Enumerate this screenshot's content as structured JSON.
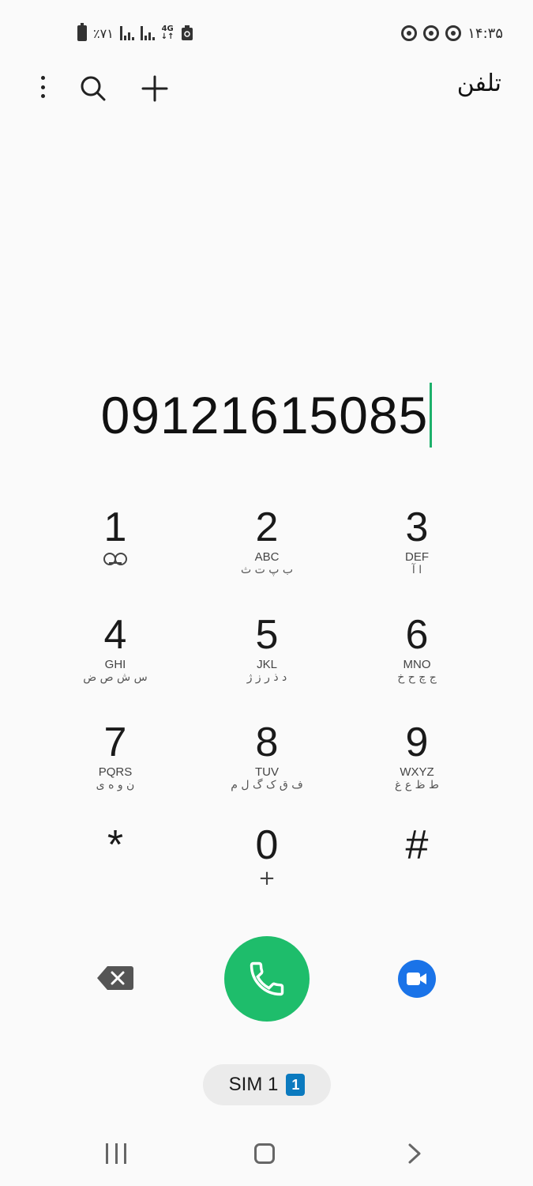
{
  "status_bar": {
    "battery_percent": "٪۷۱",
    "network_type": "4G",
    "time": "۱۴:۳۵"
  },
  "app_bar": {
    "title": "تلفن",
    "icons": [
      "more-options-icon",
      "search-icon",
      "add-icon"
    ]
  },
  "dialer": {
    "number": "09121615085"
  },
  "keypad": {
    "keys": [
      {
        "digit": "1",
        "latin": "",
        "farsi": ""
      },
      {
        "digit": "2",
        "latin": "ABC",
        "farsi": "ب پ ت ث"
      },
      {
        "digit": "3",
        "latin": "DEF",
        "farsi": "ا آ"
      },
      {
        "digit": "4",
        "latin": "GHI",
        "farsi": "س ش ص ض"
      },
      {
        "digit": "5",
        "latin": "JKL",
        "farsi": "د ذ ر ز ژ"
      },
      {
        "digit": "6",
        "latin": "MNO",
        "farsi": "ج چ ح خ"
      },
      {
        "digit": "7",
        "latin": "PQRS",
        "farsi": "ن و ه ی"
      },
      {
        "digit": "8",
        "latin": "TUV",
        "farsi": "ف ق ک گ ل م"
      },
      {
        "digit": "9",
        "latin": "WXYZ",
        "farsi": "ط ظ ع غ"
      },
      {
        "digit": "*",
        "latin": "",
        "farsi": ""
      },
      {
        "digit": "0",
        "latin": "+",
        "farsi": ""
      },
      {
        "digit": "#",
        "latin": "",
        "farsi": ""
      }
    ]
  },
  "actions": {
    "icons": [
      "backspace-icon",
      "phone-icon",
      "video-call-icon"
    ],
    "call_color": "#1ebd6b",
    "video_color": "#1a73e8"
  },
  "sim": {
    "label": "SIM 1",
    "badge": "1"
  },
  "nav_bar": {
    "icons": [
      "recents-icon",
      "home-icon",
      "back-icon"
    ]
  }
}
